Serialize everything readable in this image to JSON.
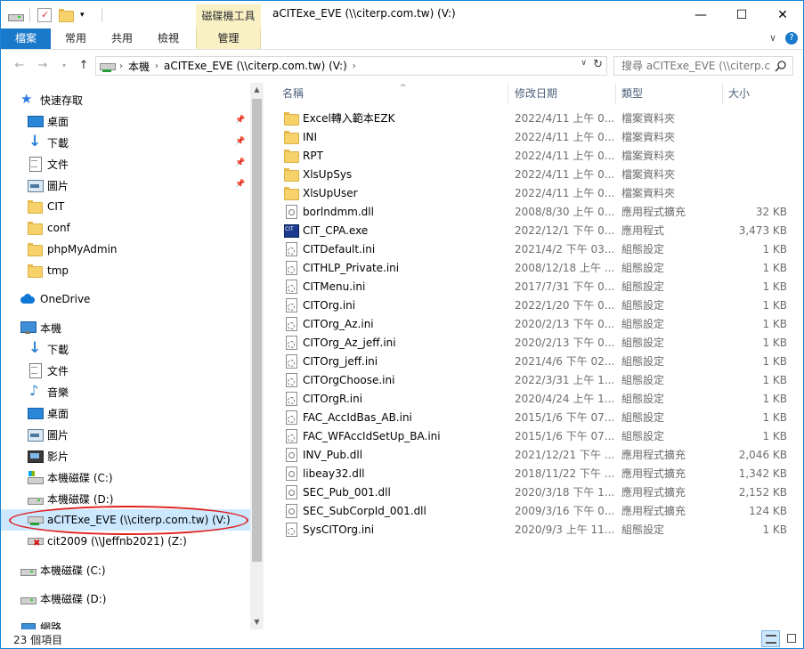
{
  "window": {
    "title": "aCITExe_EVE (\\\\citerp.com.tw) (V:)",
    "context_tab_title": "磁碟機工具",
    "controls": {
      "minimize": "—",
      "maximize": "☐",
      "close": "✕"
    }
  },
  "ribbon": {
    "tabs": [
      {
        "label": "檔案"
      },
      {
        "label": "常用"
      },
      {
        "label": "共用"
      },
      {
        "label": "檢視"
      },
      {
        "label": "管理"
      }
    ],
    "collapse": "∨",
    "help": "?"
  },
  "address": {
    "crumbs": [
      "本機",
      "aCITExe_EVE (\\\\citerp.com.tw) (V:)"
    ],
    "search_placeholder": "搜尋 aCITExe_EVE (\\\\citerp.c..."
  },
  "nav": {
    "items": [
      {
        "label": "快速存取",
        "icon": "star-icon",
        "pinned": false
      },
      {
        "label": "桌面",
        "icon": "desktop-icon",
        "pinned": true
      },
      {
        "label": "下載",
        "icon": "download-icon",
        "pinned": true
      },
      {
        "label": "文件",
        "icon": "document-icon",
        "pinned": true
      },
      {
        "label": "圖片",
        "icon": "picture-icon",
        "pinned": true
      },
      {
        "label": "CIT",
        "icon": "folder-icon",
        "pinned": false
      },
      {
        "label": "conf",
        "icon": "folder-icon",
        "pinned": false
      },
      {
        "label": "phpMyAdmin",
        "icon": "folder-icon",
        "pinned": false
      },
      {
        "label": "tmp",
        "icon": "folder-icon",
        "pinned": false
      },
      {
        "label": "OneDrive",
        "icon": "onedrive-icon",
        "pinned": false
      },
      {
        "label": "本機",
        "icon": "this-pc-icon",
        "pinned": false
      },
      {
        "label": "下載",
        "icon": "download-icon",
        "pinned": false
      },
      {
        "label": "文件",
        "icon": "document-icon",
        "pinned": false
      },
      {
        "label": "音樂",
        "icon": "music-icon",
        "pinned": false
      },
      {
        "label": "桌面",
        "icon": "desktop-icon",
        "pinned": false
      },
      {
        "label": "圖片",
        "icon": "picture-icon",
        "pinned": false
      },
      {
        "label": "影片",
        "icon": "video-icon",
        "pinned": false
      },
      {
        "label": "本機磁碟 (C:)",
        "icon": "windows-drive-icon",
        "pinned": false
      },
      {
        "label": "本機磁碟 (D:)",
        "icon": "drive-icon",
        "pinned": false
      },
      {
        "label": "aCITExe_EVE (\\\\citerp.com.tw) (V:)",
        "icon": "network-drive-icon",
        "pinned": false,
        "selected": true
      },
      {
        "label": "cit2009 (\\\\Jeffnb2021) (Z:)",
        "icon": "disconnected-drive-icon",
        "pinned": false
      },
      {
        "label": "本機磁碟 (C:)",
        "icon": "drive-icon",
        "pinned": false
      },
      {
        "label": "本機磁碟 (D:)",
        "icon": "drive-icon",
        "pinned": false
      },
      {
        "label": "網路",
        "icon": "network-icon",
        "pinned": false
      }
    ]
  },
  "columns": {
    "name": "名稱",
    "date": "修改日期",
    "type": "類型",
    "size": "大小"
  },
  "files": [
    {
      "name": "Excel轉入範本EZK",
      "date": "2022/4/11 上午 0...",
      "type": "檔案資料夾",
      "size": "",
      "icon": "folder"
    },
    {
      "name": "INI",
      "date": "2022/4/11 上午 0...",
      "type": "檔案資料夾",
      "size": "",
      "icon": "folder"
    },
    {
      "name": "RPT",
      "date": "2022/4/11 上午 0...",
      "type": "檔案資料夾",
      "size": "",
      "icon": "folder"
    },
    {
      "name": "XlsUpSys",
      "date": "2022/4/11 上午 0...",
      "type": "檔案資料夾",
      "size": "",
      "icon": "folder"
    },
    {
      "name": "XlsUpUser",
      "date": "2022/4/11 上午 0...",
      "type": "檔案資料夾",
      "size": "",
      "icon": "folder"
    },
    {
      "name": "borlndmm.dll",
      "date": "2008/8/30 上午 0...",
      "type": "應用程式擴充",
      "size": "32 KB",
      "icon": "dll"
    },
    {
      "name": "CIT_CPA.exe",
      "date": "2022/12/1 下午 0...",
      "type": "應用程式",
      "size": "3,473 KB",
      "icon": "exe"
    },
    {
      "name": "CITDefault.ini",
      "date": "2021/4/2 下午 03...",
      "type": "組態設定",
      "size": "1 KB",
      "icon": "ini"
    },
    {
      "name": "CITHLP_Private.ini",
      "date": "2008/12/18 上午 ...",
      "type": "組態設定",
      "size": "1 KB",
      "icon": "ini"
    },
    {
      "name": "CITMenu.ini",
      "date": "2017/7/31 下午 0...",
      "type": "組態設定",
      "size": "1 KB",
      "icon": "ini"
    },
    {
      "name": "CITOrg.ini",
      "date": "2022/1/20 下午 0...",
      "type": "組態設定",
      "size": "1 KB",
      "icon": "ini"
    },
    {
      "name": "CITOrg_Az.ini",
      "date": "2020/2/13 下午 0...",
      "type": "組態設定",
      "size": "1 KB",
      "icon": "ini"
    },
    {
      "name": "CITOrg_Az_jeff.ini",
      "date": "2020/2/13 下午 0...",
      "type": "組態設定",
      "size": "1 KB",
      "icon": "ini"
    },
    {
      "name": "CITOrg_jeff.ini",
      "date": "2021/4/6 下午 02...",
      "type": "組態設定",
      "size": "1 KB",
      "icon": "ini"
    },
    {
      "name": "CITOrgChoose.ini",
      "date": "2022/3/31 上午 1...",
      "type": "組態設定",
      "size": "1 KB",
      "icon": "ini"
    },
    {
      "name": "CITOrgR.ini",
      "date": "2020/4/24 上午 1...",
      "type": "組態設定",
      "size": "1 KB",
      "icon": "ini"
    },
    {
      "name": "FAC_AccIdBas_AB.ini",
      "date": "2015/1/6 下午 07...",
      "type": "組態設定",
      "size": "1 KB",
      "icon": "ini"
    },
    {
      "name": "FAC_WFAccIdSetUp_BA.ini",
      "date": "2015/1/6 下午 07...",
      "type": "組態設定",
      "size": "1 KB",
      "icon": "ini"
    },
    {
      "name": "INV_Pub.dll",
      "date": "2021/12/21 下午 ...",
      "type": "應用程式擴充",
      "size": "2,046 KB",
      "icon": "dll"
    },
    {
      "name": "libeay32.dll",
      "date": "2018/11/22 下午 ...",
      "type": "應用程式擴充",
      "size": "1,342 KB",
      "icon": "dll"
    },
    {
      "name": "SEC_Pub_001.dll",
      "date": "2020/3/18 下午 1...",
      "type": "應用程式擴充",
      "size": "2,152 KB",
      "icon": "dll"
    },
    {
      "name": "SEC_SubCorpId_001.dll",
      "date": "2009/3/16 下午 0...",
      "type": "應用程式擴充",
      "size": "124 KB",
      "icon": "dll"
    },
    {
      "name": "SysCITOrg.ini",
      "date": "2020/9/3 上午 11...",
      "type": "組態設定",
      "size": "1 KB",
      "icon": "ini"
    }
  ],
  "status": {
    "item_count": "23 個項目"
  },
  "colors": {
    "accent": "#1979ca",
    "selection": "#cce8ff",
    "highlight_ring": "#e02020",
    "context_tab": "#f9f0c4"
  }
}
